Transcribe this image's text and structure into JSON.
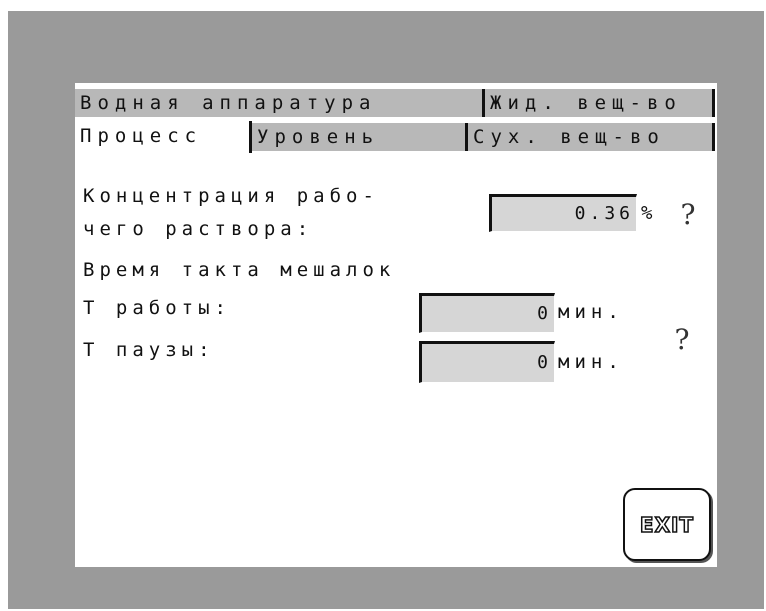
{
  "tabs": {
    "row1": [
      {
        "label": "Водная аппаратура"
      },
      {
        "label": "Жид. вещ-во"
      }
    ],
    "row2": [
      {
        "label": "Процесс"
      },
      {
        "label": "Уровень"
      },
      {
        "label": "Сух. вещ-во"
      }
    ]
  },
  "concentration": {
    "label_line1": "Концентрация рабо-",
    "label_line2": "чего раствора:",
    "value": "0.36",
    "unit": "%"
  },
  "mixer_cycle": {
    "heading": "Время такта мешалок",
    "work_label": "Т работы:",
    "work_value": "0",
    "work_unit": "мин.",
    "pause_label": "Т паузы:",
    "pause_value": "0",
    "pause_unit": "мин."
  },
  "help_glyph": "?",
  "exit_label": "EXIT"
}
